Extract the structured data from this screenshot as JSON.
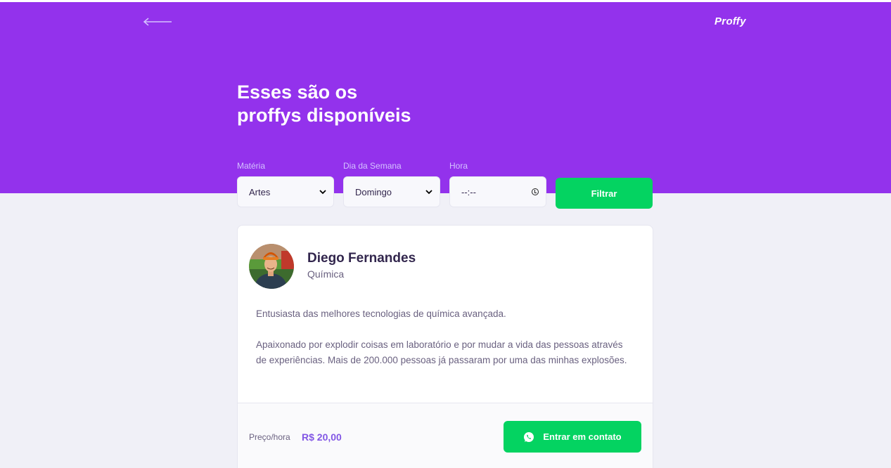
{
  "header": {
    "logo": "Proffy",
    "title_line1": "Esses são os",
    "title_line2": "proffys disponíveis"
  },
  "filters": {
    "subject_label": "Matéria",
    "subject_value": "Artes",
    "weekday_label": "Dia da Semana",
    "weekday_value": "Domingo",
    "time_label": "Hora",
    "time_value": "--:--",
    "submit_label": "Filtrar"
  },
  "teacher": {
    "name": "Diego Fernandes",
    "subject": "Química",
    "bio_p1": "Entusiasta das melhores tecnologias de química avançada.",
    "bio_p2": "Apaixonado por explodir coisas em laboratório e por mudar a vida das pessoas através de experiências. Mais de 200.000 pessoas já passaram por uma das minhas explosões.",
    "price_label": "Preço/hora",
    "price_value": "R$ 20,00",
    "contact_label": "Entrar em contato"
  },
  "colors": {
    "primary": "#9332ec",
    "accent_green": "#04d361",
    "price_purple": "#8257e5",
    "text_title": "#32264d",
    "text_body": "#6a6180",
    "background": "#f0f0f7"
  },
  "icons": [
    "back-arrow-icon",
    "chevron-down-icon",
    "clock-icon",
    "whatsapp-icon"
  ]
}
